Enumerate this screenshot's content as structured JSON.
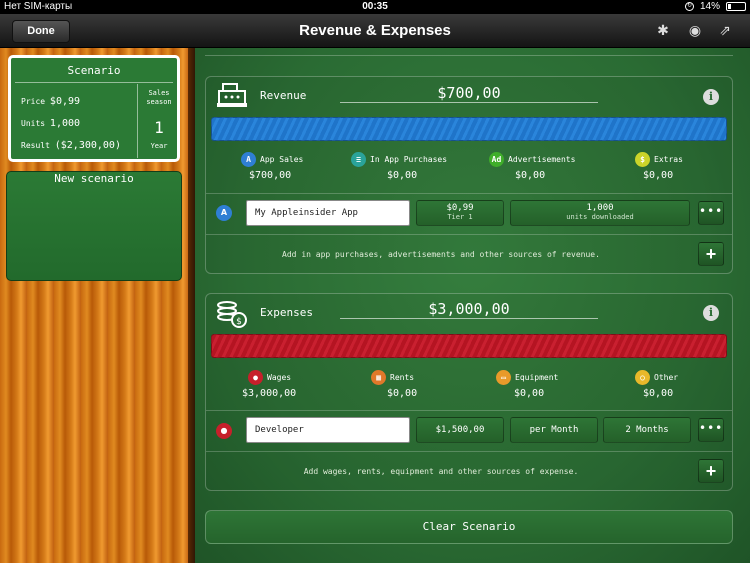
{
  "status": {
    "carrier": "Нет SIM-карты",
    "time": "00:35",
    "battery": "14%"
  },
  "nav": {
    "done": "Done",
    "title": "Revenue & Expenses",
    "icons": [
      "bug-icon",
      "info-circle-icon",
      "share-icon"
    ]
  },
  "scenario": {
    "title": "Scenario",
    "price_label": "Price",
    "price": "$0,99",
    "units_label": "Units",
    "units": "1,000",
    "result_label": "Result",
    "result": "($2,300,00)",
    "season_label": "Sales season",
    "season_value": "1",
    "season_unit": "Year"
  },
  "new_scenario": "New scenario",
  "revenue": {
    "label": "Revenue",
    "total": "$700,00",
    "bar_color": "#1f74c9",
    "icon": "cash-register-icon",
    "categories": [
      {
        "label": "App Sales",
        "value": "$700,00",
        "color": "#2f7fd4",
        "icon": "app-store-icon"
      },
      {
        "label": "In App Purchases",
        "value": "$0,00",
        "color": "#2aa39a",
        "icon": "coins-stack-icon"
      },
      {
        "label": "Advertisements",
        "value": "$0,00",
        "color": "#3fae2a",
        "icon": "ad-icon"
      },
      {
        "label": "Extras",
        "value": "$0,00",
        "color": "#cbd42a",
        "icon": "piggy-bank-icon"
      }
    ],
    "item": {
      "name": "My Appleinsider App",
      "price": "$0,99",
      "tier": "Tier 1",
      "units": "1,000",
      "units_sub": "units downloaded"
    },
    "hint": "Add in app purchases, advertisements and other sources of revenue."
  },
  "expenses": {
    "label": "Expenses",
    "total": "$3,000,00",
    "bar_color": "#b51422",
    "icon": "coins-icon",
    "categories": [
      {
        "label": "Wages",
        "value": "$3,000,00",
        "color": "#c7202b",
        "icon": "person-icon"
      },
      {
        "label": "Rents",
        "value": "$0,00",
        "color": "#e0782a",
        "icon": "building-icon"
      },
      {
        "label": "Equipment",
        "value": "$0,00",
        "color": "#e89a2a",
        "icon": "equipment-icon"
      },
      {
        "label": "Other",
        "value": "$0,00",
        "color": "#e8b82a",
        "icon": "other-icon"
      }
    ],
    "item": {
      "name": "Developer",
      "amount": "$1,500,00",
      "period": "per Month",
      "duration": "2 Months"
    },
    "hint": "Add wages, rents, equipment and other sources of expense."
  },
  "clear": "Clear Scenario"
}
